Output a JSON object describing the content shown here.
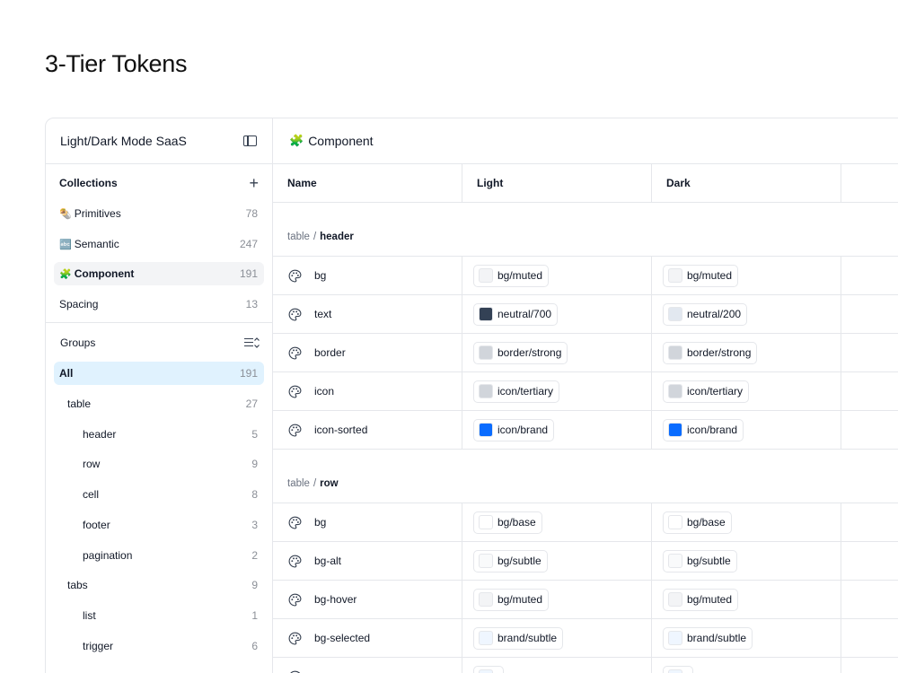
{
  "page_title": "3-Tier Tokens",
  "sidebar": {
    "title": "Light/Dark Mode SaaS",
    "collections_label": "Collections",
    "collections": [
      {
        "emoji": "🌯",
        "label": "Primitives",
        "count": "78"
      },
      {
        "emoji": "🔤",
        "label": "Semantic",
        "count": "247"
      },
      {
        "emoji": "🧩",
        "label": "Component",
        "count": "191",
        "selected": true
      },
      {
        "emoji": "",
        "label": "Spacing",
        "count": "13"
      }
    ],
    "groups_label": "Groups",
    "groups": [
      {
        "label": "All",
        "count": "191",
        "level": 0
      },
      {
        "label": "table",
        "count": "27",
        "level": 1
      },
      {
        "label": "header",
        "count": "5",
        "level": 2
      },
      {
        "label": "row",
        "count": "9",
        "level": 2
      },
      {
        "label": "cell",
        "count": "8",
        "level": 2
      },
      {
        "label": "footer",
        "count": "3",
        "level": 2
      },
      {
        "label": "pagination",
        "count": "2",
        "level": 2
      },
      {
        "label": "tabs",
        "count": "9",
        "level": 1
      },
      {
        "label": "list",
        "count": "1",
        "level": 2
      },
      {
        "label": "trigger",
        "count": "6",
        "level": 2
      }
    ]
  },
  "main": {
    "emoji": "🧩",
    "title": "Component",
    "columns": {
      "name": "Name",
      "light": "Light",
      "dark": "Dark"
    },
    "groups": [
      {
        "prefix": "table",
        "sep": "/",
        "name": "header",
        "rows": [
          {
            "name": "bg",
            "light": {
              "label": "bg/muted",
              "color": "#f3f4f6"
            },
            "dark": {
              "label": "bg/muted",
              "color": "#f3f4f6"
            }
          },
          {
            "name": "text",
            "light": {
              "label": "neutral/700",
              "color": "#334155"
            },
            "dark": {
              "label": "neutral/200",
              "color": "#e2e8f0"
            }
          },
          {
            "name": "border",
            "light": {
              "label": "border/strong",
              "color": "#d1d5db"
            },
            "dark": {
              "label": "border/strong",
              "color": "#d1d5db"
            }
          },
          {
            "name": "icon",
            "light": {
              "label": "icon/tertiary",
              "color": "#d1d5db"
            },
            "dark": {
              "label": "icon/tertiary",
              "color": "#d1d5db"
            }
          },
          {
            "name": "icon-sorted",
            "light": {
              "label": "icon/brand",
              "color": "#0a6cff"
            },
            "dark": {
              "label": "icon/brand",
              "color": "#0a6cff"
            }
          }
        ]
      },
      {
        "prefix": "table",
        "sep": "/",
        "name": "row",
        "rows": [
          {
            "name": "bg",
            "light": {
              "label": "bg/base",
              "color": "#ffffff"
            },
            "dark": {
              "label": "bg/base",
              "color": "#ffffff"
            }
          },
          {
            "name": "bg-alt",
            "light": {
              "label": "bg/subtle",
              "color": "#f9fafb"
            },
            "dark": {
              "label": "bg/subtle",
              "color": "#f9fafb"
            }
          },
          {
            "name": "bg-hover",
            "light": {
              "label": "bg/muted",
              "color": "#f3f4f6"
            },
            "dark": {
              "label": "bg/muted",
              "color": "#f3f4f6"
            }
          },
          {
            "name": "bg-selected",
            "light": {
              "label": "brand/subtle",
              "color": "#eff6ff"
            },
            "dark": {
              "label": "brand/subtle",
              "color": "#eff6ff"
            }
          },
          {
            "name": "",
            "light": {
              "label": "",
              "color": "#eff6ff"
            },
            "dark": {
              "label": "",
              "color": "#eff6ff"
            }
          }
        ]
      }
    ]
  }
}
